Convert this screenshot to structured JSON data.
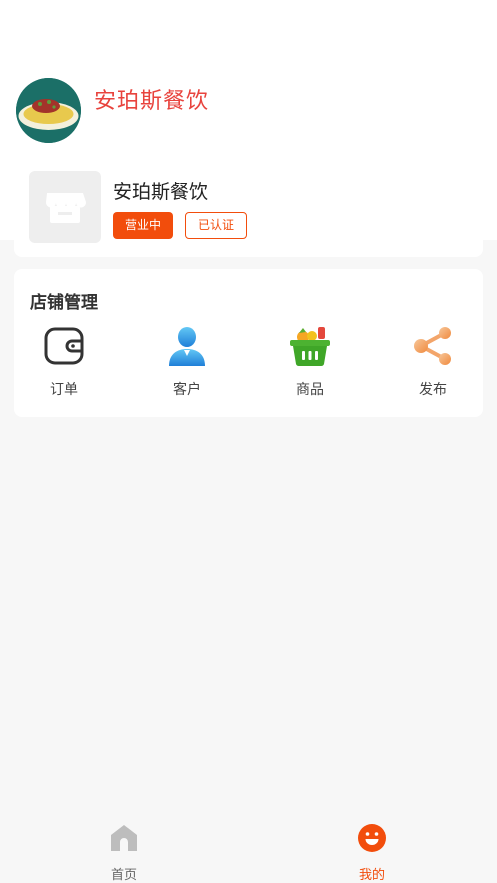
{
  "header": {
    "title": "安珀斯餐饮"
  },
  "store": {
    "name": "安珀斯餐饮",
    "status_badge": "营业中",
    "cert_badge": "已认证"
  },
  "management": {
    "title": "店铺管理",
    "items": [
      {
        "label": "订单",
        "icon": "wallet-icon"
      },
      {
        "label": "客户",
        "icon": "user-icon"
      },
      {
        "label": "商品",
        "icon": "basket-icon"
      },
      {
        "label": "发布",
        "icon": "share-icon"
      }
    ]
  },
  "tabbar": {
    "items": [
      {
        "label": "首页",
        "icon": "home-icon",
        "active": false
      },
      {
        "label": "我的",
        "icon": "smile-icon",
        "active": true
      }
    ]
  },
  "colors": {
    "accent": "#f24d0c",
    "title_red": "#e8433d",
    "inactive_gray": "#bdbdbd"
  }
}
